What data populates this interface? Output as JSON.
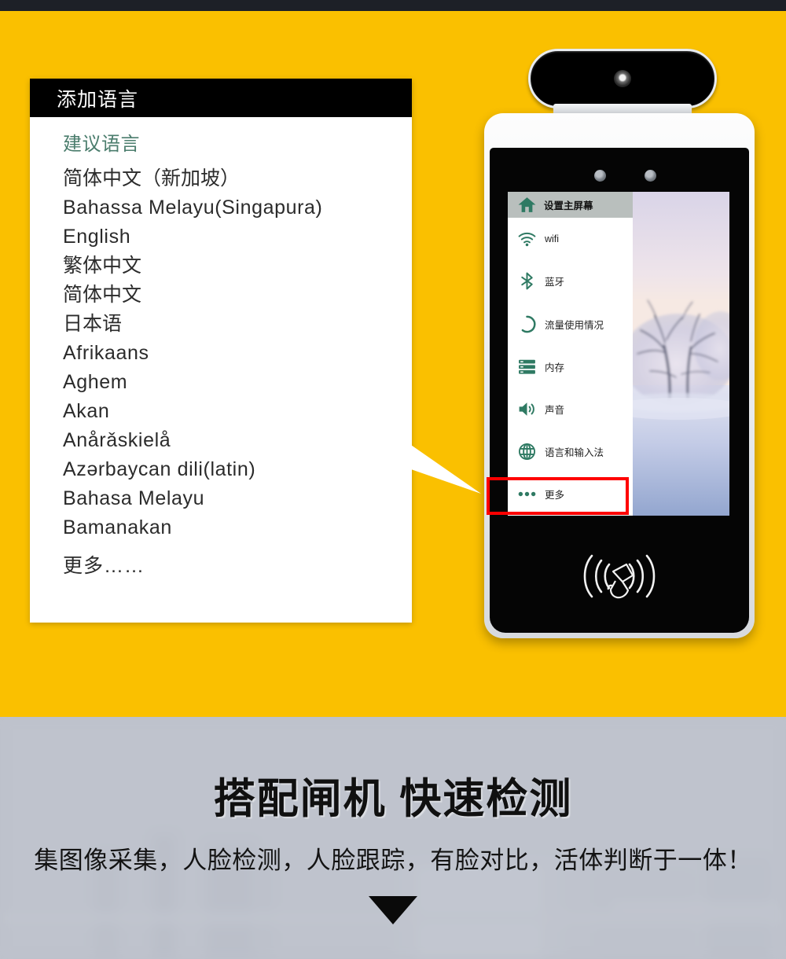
{
  "theme": {
    "accent_yellow": "#fac000",
    "panel_gray": "#bdc1cb",
    "header_black": "#000000",
    "suggested_green": "#4b7d6d",
    "highlight_red": "#ff0000"
  },
  "language_card": {
    "title": "添加语言",
    "suggested_label": "建议语言",
    "languages": [
      "简体中文（新加坡）",
      "Bahassa Melayu(Singapura)",
      "English",
      "繁体中文",
      "简体中文",
      "日本语",
      "Afrikaans",
      "Aghem",
      "Akan",
      "Anårǎskielå",
      "Azərbaycan dili(latin)",
      "Bahasa Melayu",
      "Bamanakan"
    ],
    "more_label": "更多……"
  },
  "device": {
    "settings_menu": {
      "header": {
        "label": "设置主屏幕",
        "icon": "home-icon"
      },
      "items": [
        {
          "label": "wifi",
          "icon": "wifi-icon",
          "highlighted": false
        },
        {
          "label": "蓝牙",
          "icon": "bluetooth-icon",
          "highlighted": false
        },
        {
          "label": "流量使用情况",
          "icon": "data-usage-icon",
          "highlighted": false
        },
        {
          "label": "内存",
          "icon": "storage-icon",
          "highlighted": false
        },
        {
          "label": "声音",
          "icon": "sound-icon",
          "highlighted": false
        },
        {
          "label": "语言和输入法",
          "icon": "globe-icon",
          "highlighted": true
        },
        {
          "label": "更多",
          "icon": "more-dots-icon",
          "highlighted": false
        }
      ]
    },
    "nfc_reader_icon": "nfc-card-reader-icon",
    "camera_icon": "camera-lens-icon"
  },
  "lower_section": {
    "headline": "搭配闸机 快速检测",
    "subheadline": "集图像采集，人脸检测，人脸跟踪，有脸对比，活体判断于一体！",
    "scroll_hint_icon": "chevron-down-triangle-icon"
  }
}
